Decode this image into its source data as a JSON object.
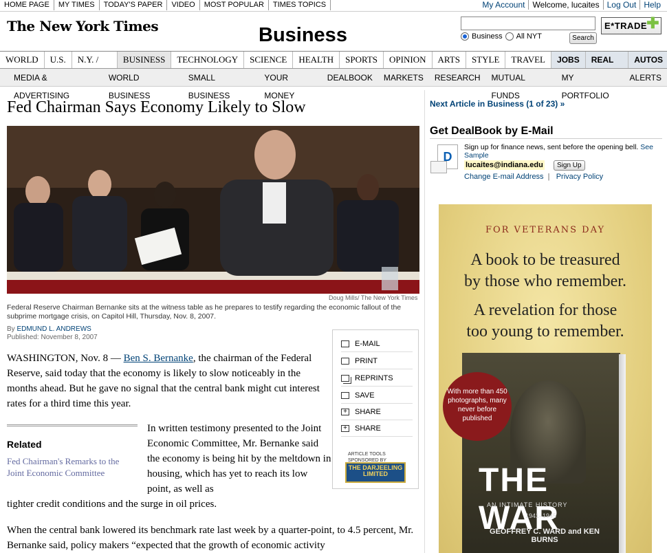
{
  "top_nav": {
    "left": [
      "HOME PAGE",
      "MY TIMES",
      "TODAY'S PAPER",
      "VIDEO",
      "MOST POPULAR",
      "TIMES TOPICS"
    ],
    "my_account": "My Account",
    "welcome": "Welcome, lucaites",
    "logout": "Log Out",
    "help": "Help"
  },
  "masthead": {
    "logo": "The New York Times",
    "section": "Business",
    "search_value": "",
    "radio_business": "Business",
    "radio_all": "All NYT",
    "search_button": "Search",
    "etrade": "E*TRADE"
  },
  "section_nav": [
    "WORLD",
    "U.S.",
    "N.Y. / REGION",
    "BUSINESS",
    "TECHNOLOGY",
    "SCIENCE",
    "HEALTH",
    "SPORTS",
    "OPINION",
    "ARTS",
    "STYLE",
    "TRAVEL",
    "JOBS",
    "REAL ESTATE",
    "AUTOS"
  ],
  "sub_nav": [
    "MEDIA & ADVERTISING",
    "WORLD BUSINESS",
    "SMALL BUSINESS",
    "YOUR MONEY",
    "DEALBOOK",
    "MARKETS",
    "RESEARCH",
    "MUTUAL FUNDS",
    "MY PORTFOLIO",
    "ALERTS"
  ],
  "article": {
    "headline": "Fed Chairman Says Economy Likely to Slow",
    "photo_credit": "Doug Mills/ The New York Times",
    "caption": "Federal Reserve Chairman Bernanke sits at the witness table as he prepares to testify regarding the economic fallout of the subprime mortgage crisis, on Capitol Hill, Thursday, Nov. 8, 2007.",
    "by": "By ",
    "author": "EDMUND L. ANDREWS",
    "published": "Published: November 8, 2007",
    "p1_lead": "WASHINGTON, Nov. 8 — ",
    "p1_link": "Ben S. Bernanke",
    "p1_rest": ", the chairman of the Federal Reserve, said today that the economy is likely to slow noticeably in the months ahead. But he gave no signal that the central bank might cut interest rates for a third time this year.",
    "p2": "In written testimony presented to the Joint Economic Committee, Mr. Bernanke said the economy is being hit by the meltdown in housing, which has yet to reach its low point, as well as",
    "p2_cont": "tighter credit conditions and the surge in oil prices.",
    "p3": "When the central bank lowered its benchmark rate last week by a quarter-point, to 4.5 percent, Mr. Bernanke said, policy makers “expected that the growth of economic activity"
  },
  "related": {
    "title": "Related",
    "link": "Fed Chairman's Remarks to the Joint Economic Committee"
  },
  "tools": {
    "items": [
      "E-MAIL",
      "PRINT",
      "REPRINTS",
      "SAVE",
      "SHARE",
      "SHARE"
    ],
    "sponsor": "ARTICLE TOOLS SPONSORED BY",
    "sponsor_name": "THE DARJEELING LIMITED"
  },
  "right": {
    "next_article": "Next Article in Business (1 of 23) »",
    "deal_title": "Get DealBook by E-Mail",
    "deal_text": "Sign up for finance news, sent before the opening bell.",
    "see_sample": "See Sample",
    "email": "lucaites@indiana.edu",
    "signup": "Sign Up",
    "change_email": "Change E-mail Address",
    "privacy": "Privacy Policy"
  },
  "ad": {
    "veterans": "FOR VETERANS DAY",
    "line1": "A book to be treasured",
    "line2": "by those who remember.",
    "line3": "A revelation for those",
    "line4": "too young to remember.",
    "badge": "With more than 450 photographs, many never before published",
    "title": "THE WAR",
    "subtitle": "AN INTIMATE HISTORY",
    "years": "1941–1945",
    "authors": "GEOFFREY C. WARD and KEN BURNS"
  },
  "colors": {
    "link": "#004276",
    "related_link": "#636aa0",
    "ad_red": "#8b2a1c"
  }
}
